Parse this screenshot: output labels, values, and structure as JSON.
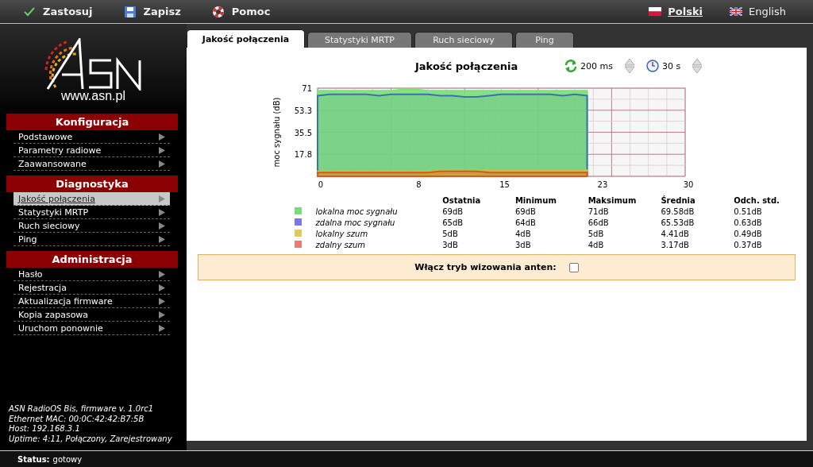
{
  "toolbar": {
    "actions": [
      {
        "kind": "apply",
        "label": "Zastosuj"
      },
      {
        "kind": "save",
        "label": "Zapisz"
      },
      {
        "kind": "help",
        "label": "Pomoc"
      }
    ],
    "languages": [
      {
        "kind": "pl",
        "label": "Polski",
        "selected": true
      },
      {
        "kind": "en",
        "label": "English",
        "selected": false
      }
    ]
  },
  "sidebar": {
    "logo_url": "www.asn.pl",
    "sections": [
      {
        "title": "Konfiguracja",
        "items": [
          {
            "label": "Podstawowe",
            "selected": false
          },
          {
            "label": "Parametry radiowe",
            "selected": false
          },
          {
            "label": "Zaawansowane",
            "selected": false
          }
        ]
      },
      {
        "title": "Diagnostyka",
        "items": [
          {
            "label": "Jakość połączenia",
            "selected": true
          },
          {
            "label": "Statystyki MRTP",
            "selected": false
          },
          {
            "label": "Ruch sieciowy",
            "selected": false
          },
          {
            "label": "Ping",
            "selected": false
          }
        ]
      },
      {
        "title": "Administracja",
        "items": [
          {
            "label": "Hasło",
            "selected": false
          },
          {
            "label": "Rejestracja",
            "selected": false
          },
          {
            "label": "Aktualizacja firmware",
            "selected": false
          },
          {
            "label": "Kopia zapasowa",
            "selected": false
          },
          {
            "label": "Uruchom ponownie",
            "selected": false
          }
        ]
      }
    ],
    "info": [
      "ASN RadioOS Bis, firmware v. 1.0rc1",
      "Ethernet MAC: 00:0C:42:42:B7:5B",
      "Host: 192.168.3.1",
      "Uptime:  4:11, Połączony, Zarejestrowany"
    ]
  },
  "tabs": [
    {
      "label": "Jakość połączenia",
      "selected": true
    },
    {
      "label": "Statystyki MRTP",
      "selected": false
    },
    {
      "label": "Ruch sieciowy",
      "selected": false
    },
    {
      "label": "Ping",
      "selected": false
    }
  ],
  "controls": {
    "refresh": "200 ms",
    "window": "30 s"
  },
  "chart_data": {
    "type": "area",
    "title": "Jakość połączenia",
    "ylabel": "moc sygnału (dB)",
    "x": [
      0,
      1,
      2,
      3,
      4,
      5,
      6,
      7,
      8,
      9,
      10,
      11,
      12,
      13,
      14,
      15,
      16,
      17,
      18,
      19,
      20,
      21,
      22
    ],
    "xlim": [
      0,
      30
    ],
    "ylim": [
      0,
      71
    ],
    "xticks": [
      0,
      8,
      15,
      23,
      30
    ],
    "grid": true,
    "yticks": [
      17.8,
      35.5,
      53.3,
      71
    ],
    "series": [
      {
        "name": "lokalna moc sygnału",
        "color": "#7ce07c",
        "values": [
          69,
          69,
          69,
          69,
          69,
          69,
          69,
          70,
          70,
          69,
          69,
          69,
          69,
          69,
          69,
          69,
          69,
          69,
          69,
          69,
          69,
          69,
          69
        ]
      },
      {
        "name": "zdalna moc sygnału",
        "color": "#3f6fb0",
        "values": [
          65,
          66,
          66,
          66,
          66,
          65,
          66,
          66,
          66,
          66,
          65,
          65,
          64,
          64,
          65,
          66,
          66,
          66,
          66,
          66,
          65,
          66,
          65
        ]
      },
      {
        "name": "lokalny szum",
        "color": "#c8c040",
        "values": [
          4,
          4,
          4,
          4,
          4,
          4,
          4,
          4,
          4,
          4,
          5,
          5,
          5,
          5,
          5,
          5,
          5,
          5,
          5,
          5,
          5,
          5,
          5
        ]
      },
      {
        "name": "zdalny szum",
        "color": "#d05a28",
        "values": [
          3,
          3,
          3,
          3,
          3,
          3,
          3,
          3,
          3,
          3,
          4,
          4,
          4,
          4,
          3,
          3,
          3,
          3,
          3,
          3,
          3,
          3,
          3
        ]
      }
    ]
  },
  "stats": {
    "columns": [
      "Ostatnia",
      "Minimum",
      "Maksimum",
      "Średnia",
      "Odch. std."
    ],
    "rows": [
      {
        "color": "#77dd77",
        "cells": [
          "69dB",
          "69dB",
          "71dB",
          "69.58dB",
          "0.51dB"
        ]
      },
      {
        "color": "#7777ee",
        "cells": [
          "65dB",
          "64dB",
          "66dB",
          "65.53dB",
          "0.63dB"
        ]
      },
      {
        "color": "#ddcc55",
        "cells": [
          "5dB",
          "4dB",
          "5dB",
          "4.41dB",
          "0.49dB"
        ]
      },
      {
        "color": "#ee7777",
        "cells": [
          "3dB",
          "3dB",
          "4dB",
          "3.17dB",
          "0.37dB"
        ]
      }
    ]
  },
  "antenna_mode": {
    "label": "Włącz tryb wizowania anten:",
    "checked": false
  },
  "status_bar": {
    "label": "Status:",
    "value": "gotowy"
  }
}
